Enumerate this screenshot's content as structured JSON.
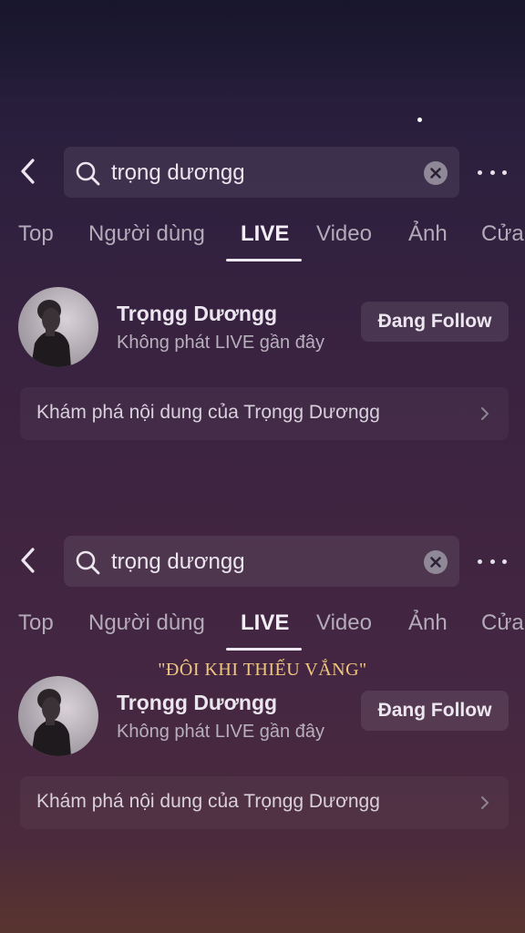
{
  "caption": "\"ĐÔI KHI THIẾU VẮNG\"",
  "panels": [
    {
      "search": {
        "query": "trọng dươngg"
      },
      "tabs": [
        "Top",
        "Người dùng",
        "LIVE",
        "Video",
        "Ảnh",
        "Cửa"
      ],
      "active_tab": "LIVE",
      "user": {
        "name": "Trọngg Dươngg",
        "status": "Không phát LIVE gần đây",
        "follow_label": "Đang Follow"
      },
      "explore_label": "Khám phá nội dung của Trọngg Dươngg"
    },
    {
      "search": {
        "query": "trọng dươngg"
      },
      "tabs": [
        "Top",
        "Người dùng",
        "LIVE",
        "Video",
        "Ảnh",
        "Cửa"
      ],
      "active_tab": "LIVE",
      "user": {
        "name": "Trọngg Dươngg",
        "status": "Không phát LIVE gần đây",
        "follow_label": "Đang Follow"
      },
      "explore_label": "Khám phá nội dung của Trọngg Dươngg"
    }
  ],
  "icons": {
    "back": "chevron-left-icon",
    "search": "search-icon",
    "clear": "clear-x-circle-icon",
    "more": "more-horizontal-icon",
    "explore_arrow": "chevron-right-icon"
  },
  "colors": {
    "caption": "#f0c780",
    "background_top": "#1d1a33",
    "background_bottom": "#523032"
  }
}
